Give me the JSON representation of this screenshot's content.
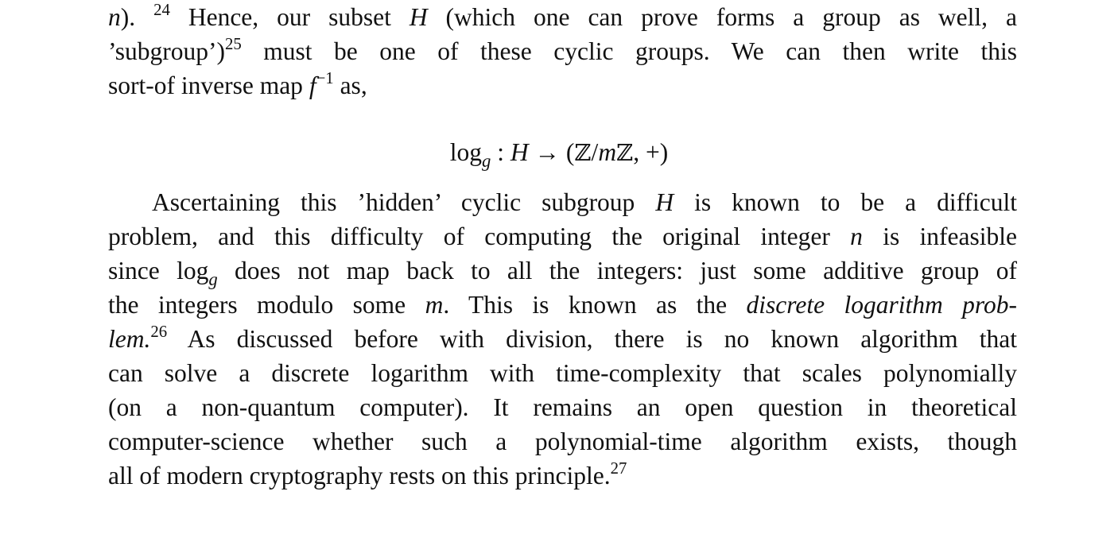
{
  "paragraph1": {
    "l1_n": "n",
    "l1_a": "). ",
    "l1_fn": "24",
    "l1_b": " Hence, our subset ",
    "l1_H": "H",
    "l1_c": " (which one can prove forms a group as well, a",
    "l2_a": "’subgroup’)",
    "l2_fn": "25",
    "l2_b": " must be one of these cyclic groups. We can then write this",
    "l3_a": "sort-of inverse map ",
    "l3_f": "f",
    "l3_exp": "−1",
    "l3_b": " as,"
  },
  "equation": {
    "log": "log",
    "sub": "g",
    "colon": " : ",
    "H": "H",
    "arrow": " → (",
    "Z1": "ℤ",
    "slash": "/",
    "m": "m",
    "Z2": "ℤ",
    "tail": ", +)"
  },
  "paragraph2": {
    "l1_a": "Ascertaining this ’hidden’ cyclic subgroup ",
    "l1_H": "H",
    "l1_b": " is known to be a difficult",
    "l2_a": "problem, and this difficulty of computing the original integer ",
    "l2_n": "n",
    "l2_b": " is infeasible",
    "l3_a": "since log",
    "l3_sub": "g",
    "l3_b": " does not map back to all the integers: just some additive group of",
    "l4_a": "the integers modulo some ",
    "l4_m": "m",
    "l4_b": ". This is known as the ",
    "l4_em": "discrete logarithm prob-",
    "l5_em": "lem.",
    "l5_fn": "26",
    "l5_b": " As discussed before with division, there is no known algorithm that",
    "l6": "can solve a discrete logarithm with time-complexity that scales polynomially",
    "l7": "(on a non-quantum computer). It remains an open question in theoretical",
    "l8": "computer-science whether such a polynomial-time algorithm exists, though",
    "l9_a": "all of modern cryptography rests on this principle.",
    "l9_fn": "27"
  }
}
